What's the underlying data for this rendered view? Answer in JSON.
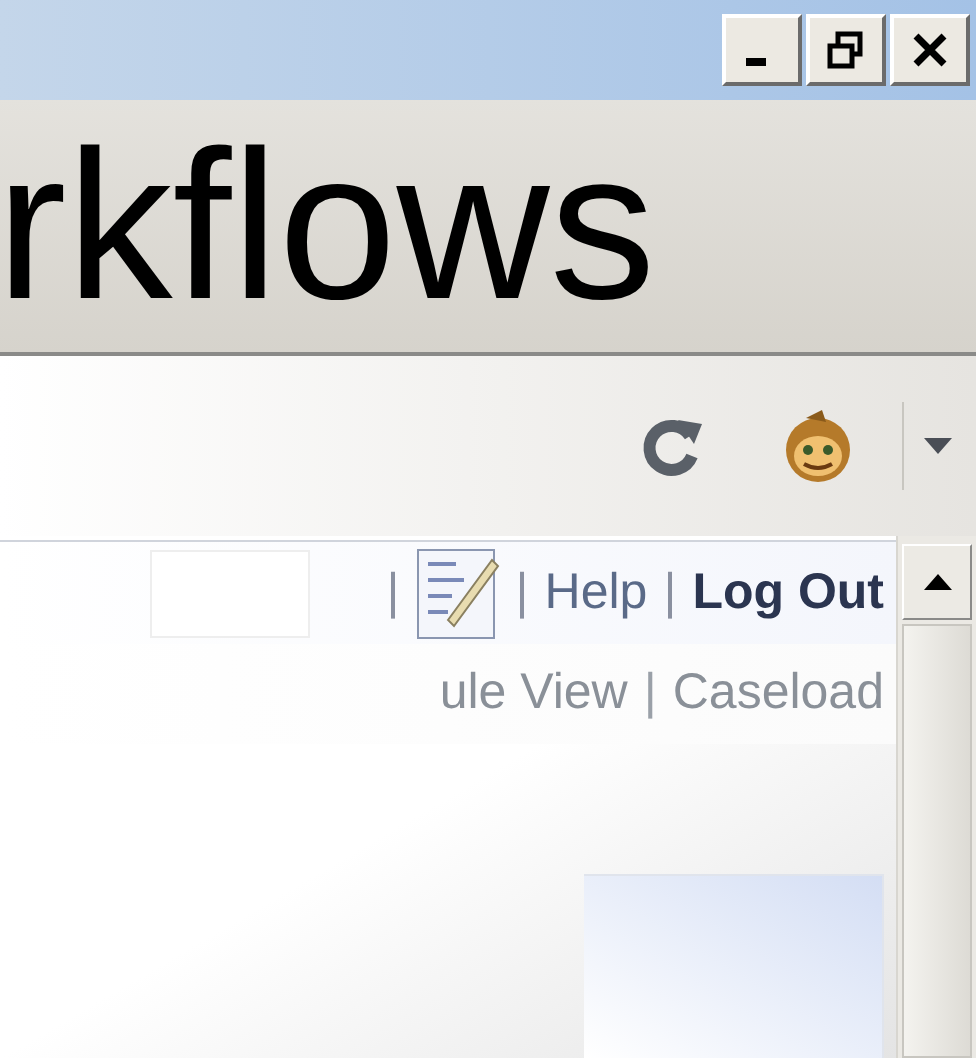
{
  "heading": {
    "text": "rkflows"
  },
  "header_links": [
    {
      "kind": "separator",
      "text": "|"
    },
    {
      "kind": "icon"
    },
    {
      "kind": "separator",
      "text": "|"
    },
    {
      "kind": "link",
      "text": "Help",
      "strong": false
    },
    {
      "kind": "separator",
      "text": "|"
    },
    {
      "kind": "link",
      "text": "Log Out",
      "strong": true
    }
  ],
  "nav_links": [
    {
      "kind": "link",
      "text": "ule View",
      "strong": false
    },
    {
      "kind": "separator",
      "text": "|"
    },
    {
      "kind": "link",
      "text": "Caseload",
      "strong": false
    }
  ]
}
